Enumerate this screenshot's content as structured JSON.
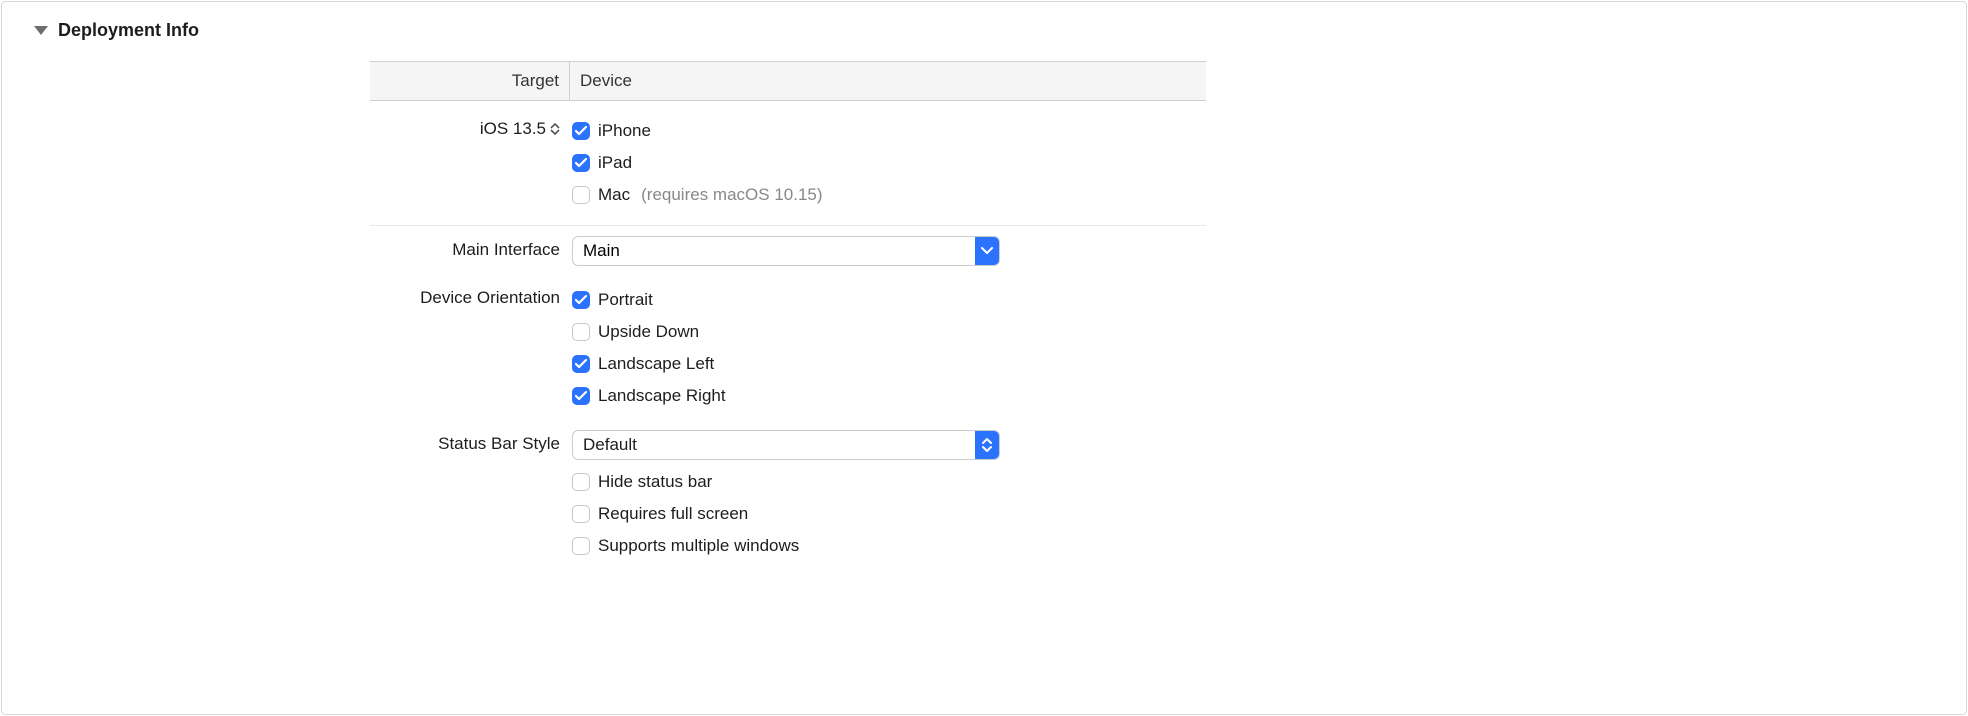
{
  "section_title": "Deployment Info",
  "columns": {
    "target": "Target",
    "device": "Device"
  },
  "target": {
    "label": "iOS 13.5"
  },
  "devices": [
    {
      "label": "iPhone",
      "checked": true,
      "hint": ""
    },
    {
      "label": "iPad",
      "checked": true,
      "hint": ""
    },
    {
      "label": "Mac",
      "checked": false,
      "hint": "(requires macOS 10.15)"
    }
  ],
  "main_interface": {
    "label": "Main Interface",
    "value": "Main"
  },
  "orientation": {
    "label": "Device Orientation",
    "options": [
      {
        "label": "Portrait",
        "checked": true
      },
      {
        "label": "Upside Down",
        "checked": false
      },
      {
        "label": "Landscape Left",
        "checked": true
      },
      {
        "label": "Landscape Right",
        "checked": true
      }
    ]
  },
  "status_bar": {
    "label": "Status Bar Style",
    "value": "Default",
    "options": [
      {
        "label": "Hide status bar",
        "checked": false
      },
      {
        "label": "Requires full screen",
        "checked": false
      },
      {
        "label": "Supports multiple windows",
        "checked": false
      }
    ]
  }
}
